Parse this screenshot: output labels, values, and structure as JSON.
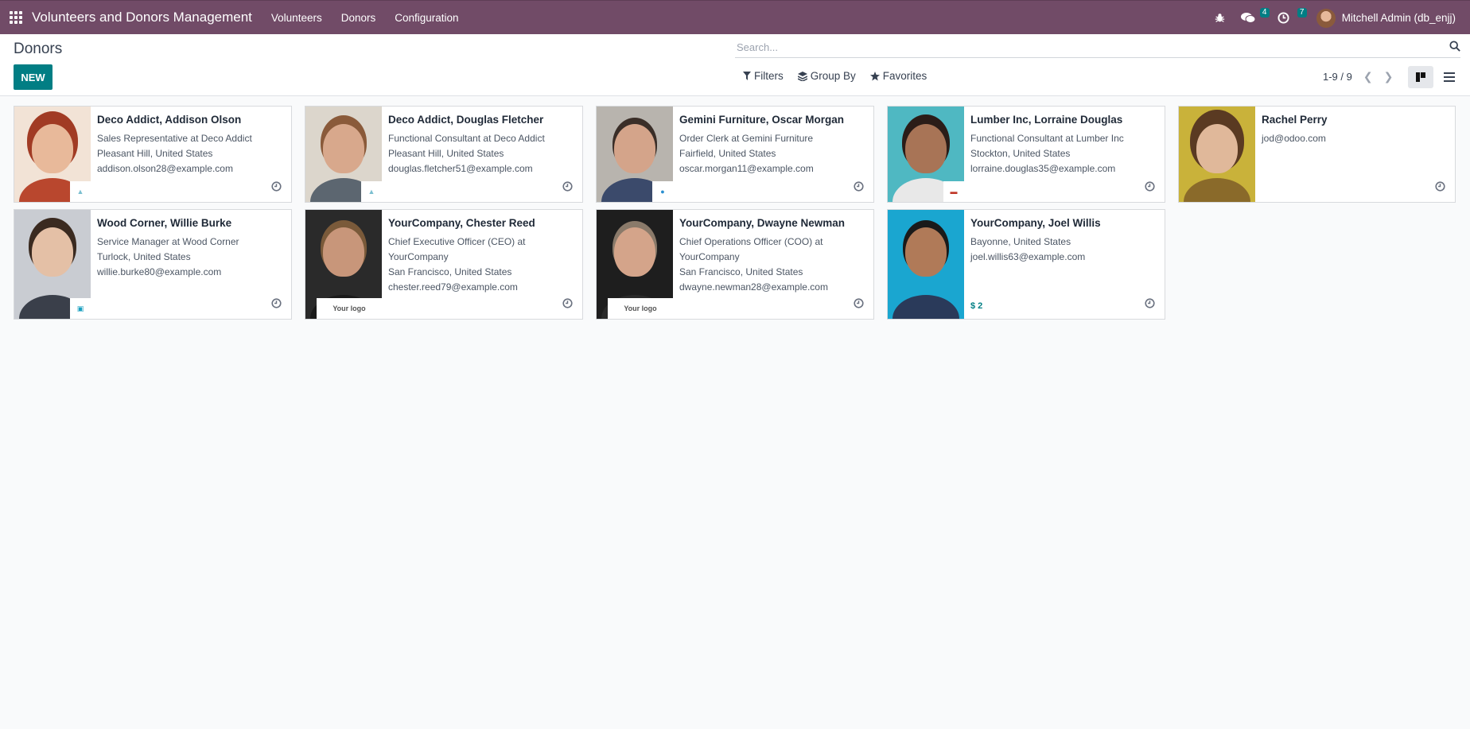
{
  "navbar": {
    "app_title": "Volunteers and Donors Management",
    "menus": [
      "Volunteers",
      "Donors",
      "Configuration"
    ],
    "messages_count": "4",
    "activities_count": "7",
    "user": "Mitchell Admin (db_enjj)"
  },
  "control": {
    "title": "Donors",
    "new_label": "NEW",
    "search_placeholder": "Search...",
    "filters_label": "Filters",
    "groupby_label": "Group By",
    "favorites_label": "Favorites",
    "pager": "1-9 / 9"
  },
  "cards": [
    {
      "name": "Deco Addict, Addison Olson",
      "lines": [
        "Sales Representative at Deco Addict",
        "Pleasant Hill, United States",
        "addison.olson28@example.com"
      ],
      "logo": "deco"
    },
    {
      "name": "Deco Addict, Douglas Fletcher",
      "lines": [
        "Functional Consultant at Deco Addict",
        "Pleasant Hill, United States",
        "douglas.fletcher51@example.com"
      ],
      "logo": "deco"
    },
    {
      "name": "Gemini Furniture, Oscar Morgan",
      "lines": [
        "Order Clerk at Gemini Furniture",
        "Fairfield, United States",
        "oscar.morgan11@example.com"
      ],
      "logo": "gemini"
    },
    {
      "name": "Lumber Inc, Lorraine Douglas",
      "lines": [
        "Functional Consultant at Lumber Inc",
        "Stockton, United States",
        "lorraine.douglas35@example.com"
      ],
      "logo": "lumber"
    },
    {
      "name": "Rachel Perry",
      "lines": [
        "jod@odoo.com"
      ],
      "logo": ""
    },
    {
      "name": "Wood Corner, Willie Burke",
      "lines": [
        "Service Manager at Wood Corner",
        "Turlock, United States",
        "willie.burke80@example.com"
      ],
      "logo": "wood"
    },
    {
      "name": "YourCompany, Chester Reed",
      "lines": [
        "Chief Executive Officer (CEO) at",
        "YourCompany",
        "San Francisco, United States",
        "chester.reed79@example.com"
      ],
      "logo": "yourlogo"
    },
    {
      "name": "YourCompany, Dwayne Newman",
      "lines": [
        "Chief Operations Officer (COO) at",
        "YourCompany",
        "San Francisco, United States",
        "dwayne.newman28@example.com"
      ],
      "logo": "yourlogo"
    },
    {
      "name": "YourCompany, Joel Willis",
      "lines": [
        "Bayonne, United States",
        "joel.willis63@example.com"
      ],
      "logo": "",
      "donation": "$ 2"
    }
  ],
  "logo_text": "Your logo",
  "colors": {
    "navbar": "#714b67",
    "accent": "#017e84"
  }
}
